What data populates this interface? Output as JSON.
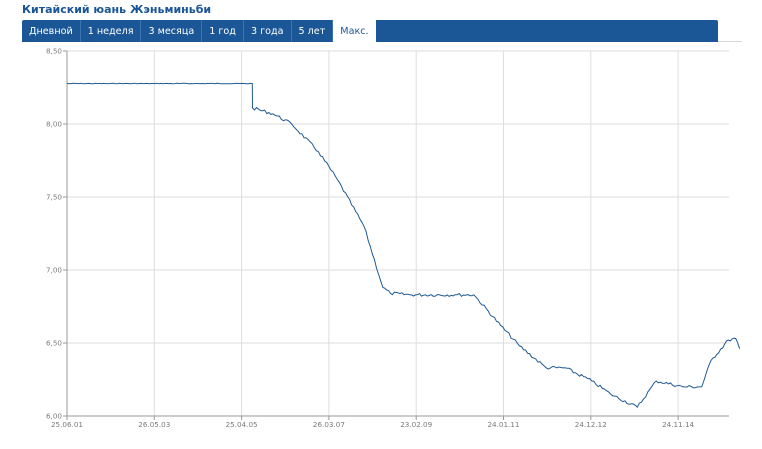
{
  "header": {
    "title": "Китайский юань Жэньминьби",
    "tabs": [
      {
        "label": "Дневной",
        "active": false
      },
      {
        "label": "1 неделя",
        "active": false
      },
      {
        "label": "3 месяца",
        "active": false
      },
      {
        "label": "1 год",
        "active": false
      },
      {
        "label": "3 года",
        "active": false
      },
      {
        "label": "5 лет",
        "active": false
      },
      {
        "label": "Макс.",
        "active": true
      }
    ]
  },
  "colors": {
    "accent": "#1b5796",
    "line": "#1f5a92",
    "grid": "#dedede",
    "text": "#7a7a7a"
  },
  "chart_data": {
    "type": "line",
    "title": "",
    "xlabel": "",
    "ylabel": "",
    "ylim": [
      6.0,
      8.5
    ],
    "y_ticks": [
      "8,50",
      "8,00",
      "7,50",
      "7,00",
      "6,50",
      "6,00"
    ],
    "x_ticks": [
      "25.06.01",
      "26.05.03",
      "25.04.05",
      "26.03.07",
      "23.02.09",
      "24.01.11",
      "24.12.12",
      "24.11.14"
    ],
    "grid": true,
    "series": [
      {
        "points": [
          [
            "25.06.01",
            8.277
          ],
          [
            "01.06.02",
            8.277
          ],
          [
            "01.06.03",
            8.277
          ],
          [
            "01.06.04",
            8.277
          ],
          [
            "20.07.05",
            8.277
          ],
          [
            "21.07.05",
            8.11
          ],
          [
            "01.01.06",
            8.07
          ],
          [
            "01.06.06",
            8.0
          ],
          [
            "01.01.07",
            7.81
          ],
          [
            "01.06.07",
            7.62
          ],
          [
            "01.01.08",
            7.3
          ],
          [
            "01.06.08",
            6.88
          ],
          [
            "01.08.08",
            6.84
          ],
          [
            "01.01.09",
            6.83
          ],
          [
            "01.01.10",
            6.83
          ],
          [
            "01.06.10",
            6.83
          ],
          [
            "01.01.11",
            6.62
          ],
          [
            "01.06.11",
            6.48
          ],
          [
            "01.01.12",
            6.33
          ],
          [
            "01.06.12",
            6.33
          ],
          [
            "01.01.13",
            6.24
          ],
          [
            "01.06.13",
            6.15
          ],
          [
            "01.01.14",
            6.06
          ],
          [
            "01.06.14",
            6.24
          ],
          [
            "01.01.15",
            6.2
          ],
          [
            "01.06.15",
            6.2
          ],
          [
            "15.08.15",
            6.38
          ],
          [
            "01.01.16",
            6.52
          ],
          [
            "01.03.16",
            6.53
          ],
          [
            "31.03.16",
            6.46
          ]
        ]
      }
    ]
  }
}
